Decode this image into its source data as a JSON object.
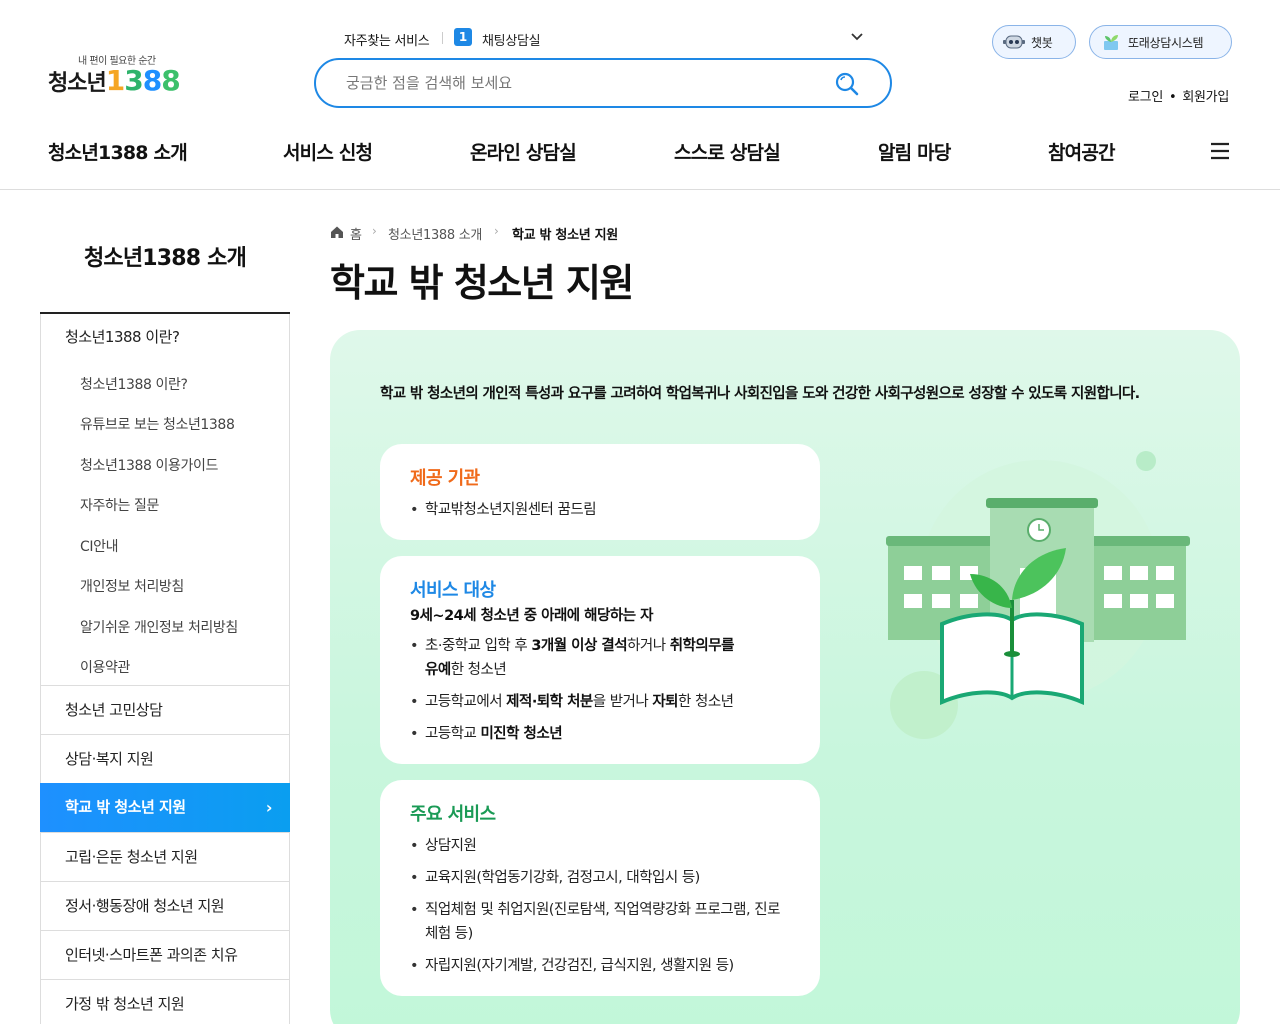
{
  "header": {
    "logo_tagline": "내 편이 필요한 순간",
    "logo_text": "청소년",
    "logo_digit1": "1",
    "logo_digit2": "3",
    "logo_digit3": "8",
    "logo_digit4": "8",
    "quick_label": "자주찾는 서비스",
    "quick_badge": "1",
    "quick_item": "채팅상담실",
    "search_placeholder": "궁금한 점을 검색해 보세요",
    "chatbot_label": "챗봇",
    "peer_label": "또래상담시스템",
    "login": "로그인",
    "auth_dot": "•",
    "signup": "회원가입"
  },
  "gnb": {
    "items": [
      "청소년1388 소개",
      "서비스 신청",
      "온라인 상담실",
      "스스로 상담실",
      "알림 마당",
      "참여공간"
    ]
  },
  "sidebar": {
    "title": "청소년1388 소개",
    "group1": "청소년1388 이란?",
    "subitems": [
      "청소년1388 이란?",
      "유튜브로 보는 청소년1388",
      "청소년1388 이용가이드",
      "자주하는 질문",
      "CI안내",
      "개인정보 처리방침",
      "알기쉬운 개인정보 처리방침",
      "이용약관"
    ],
    "items": [
      "청소년 고민상담",
      "상담·복지 지원",
      "학교 밖 청소년 지원",
      "고립·은둔 청소년 지원",
      "정서·행동장애 청소년 지원",
      "인터넷·스마트폰 과의존 치유",
      "가정 밖 청소년 지원"
    ],
    "active_index": 2,
    "active_arrow": "›"
  },
  "breadcrumb": {
    "home": "홈",
    "level1": "청소년1388 소개",
    "current": "학교 밖 청소년 지원"
  },
  "main": {
    "title": "학교 밖 청소년 지원",
    "intro": "학교 밖 청소년의 개인적 특성과 요구를 고려하여 학업복귀나 사회진입을 도와 건강한 사회구성원으로 성장할 수 있도록 지원합니다.",
    "provider": {
      "title": "제공 기관",
      "items": [
        "학교밖청소년지원센터 꿈드림"
      ]
    },
    "target": {
      "title": "서비스 대상",
      "subtitle": "9세~24세 청소년 중 아래에 해당하는 자",
      "b1_a": "초·중학교 입학 후 ",
      "b1_b": "3개월 이상 결석",
      "b1_c": "하거나 ",
      "b1_d": "취학의무를",
      "b1_e": "유예",
      "b1_f": "한 청소년",
      "b2_a": "고등학교에서 ",
      "b2_b": "제적·퇴학 처분",
      "b2_c": "을 받거나 ",
      "b2_d": "자퇴",
      "b2_e": "한 청소년",
      "b3_a": "고등학교 ",
      "b3_b": "미진학 청소년"
    },
    "services": {
      "title": "주요 서비스",
      "items": [
        "상담지원",
        "교육지원(학업동기강화, 검정고시, 대학입시 등)",
        "직업체험 및 취업지원(진로탐색, 직업역량강화 프로그램, 진로체험 등)",
        "자립지원(자기계발, 건강검진, 급식지원, 생활지원 등)"
      ]
    }
  },
  "colors": {
    "accent": "#1e88e5",
    "provider_title": "#f06a1a",
    "target_title": "#1e88e5",
    "services_title": "#1a9a55",
    "panel_bg": "#d6f7e5"
  }
}
